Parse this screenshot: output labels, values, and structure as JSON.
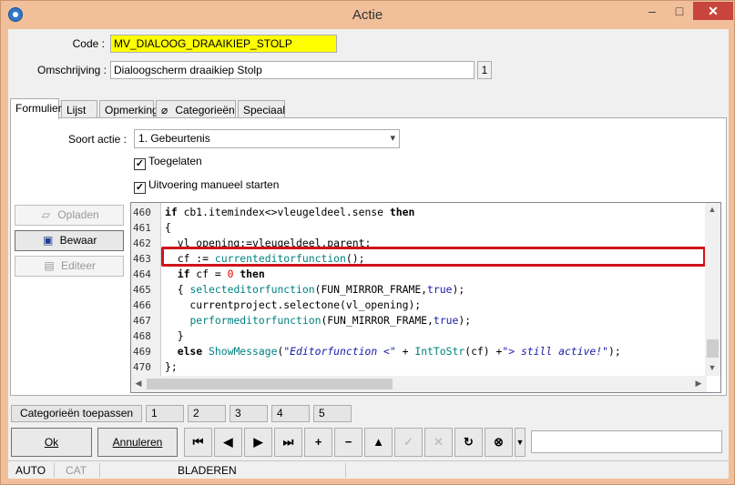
{
  "window": {
    "title": "Actie",
    "minimize": "–",
    "maximize": "□",
    "close": "✕"
  },
  "form": {
    "code_label": "Code :",
    "code_value": "MV_DIALOOG_DRAAIKIEP_STOLP",
    "code_bg": "#ffff00",
    "omschrijving_label": "Omschrijving :",
    "omschrijving_value": "Dialoogscherm draaikiep Stolp",
    "omschrijving_counter": "1"
  },
  "tabs": [
    "Formulier",
    "Lijst",
    "Opmerking",
    "Categorieën",
    "Speciaal"
  ],
  "formulier": {
    "soort_label": "Soort actie :",
    "soort_value": "1.  Gebeurtenis",
    "toegelaten": "Toegelaten",
    "uitvoering": "Uitvoering manueel starten"
  },
  "side_buttons": {
    "opladen": "Opladen",
    "bewaar": "Bewaar",
    "editeer": "Editeer"
  },
  "code": {
    "line_numbers": [
      "460",
      "461",
      "462",
      "463",
      "464",
      "465",
      "466",
      "467",
      "468",
      "469",
      "470"
    ],
    "highlight_color": "#d0131a"
  },
  "category_bar": {
    "apply_label": "Categorieën toepassen",
    "numbers": [
      "1",
      "2",
      "3",
      "4",
      "5"
    ]
  },
  "buttons": {
    "ok": "Ok",
    "annuleren": "Annuleren"
  },
  "nav_icons": [
    "first-icon",
    "prev-icon",
    "next-icon",
    "last-icon",
    "plus-icon",
    "minus-icon",
    "up-icon",
    "check-icon",
    "cancel-icon",
    "refresh-icon",
    "binoculars-icon",
    "dropdown-icon"
  ],
  "status": {
    "auto": "AUTO",
    "cat": "CAT",
    "mode": "BLADEREN"
  }
}
